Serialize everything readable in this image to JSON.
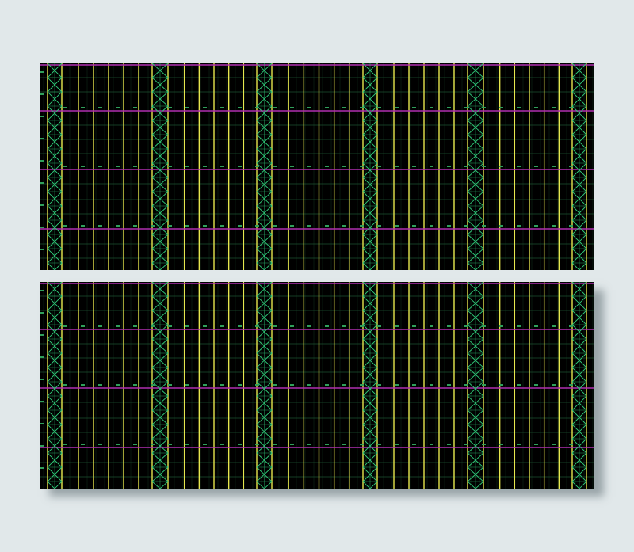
{
  "colors": {
    "page_background": "#e1e8ea",
    "drawing_background": "#000000",
    "grid_line": "#1f5a34",
    "column_line": "#e6e64e",
    "beam_line": "#b02fb0",
    "bracing_line": "#2fc878",
    "label_text": "#2fa05a"
  },
  "drawing": {
    "description_type": "structural framing plan (CAD)",
    "panel_count": 2,
    "panels": [
      {
        "name": "top"
      },
      {
        "name": "bottom"
      }
    ]
  }
}
